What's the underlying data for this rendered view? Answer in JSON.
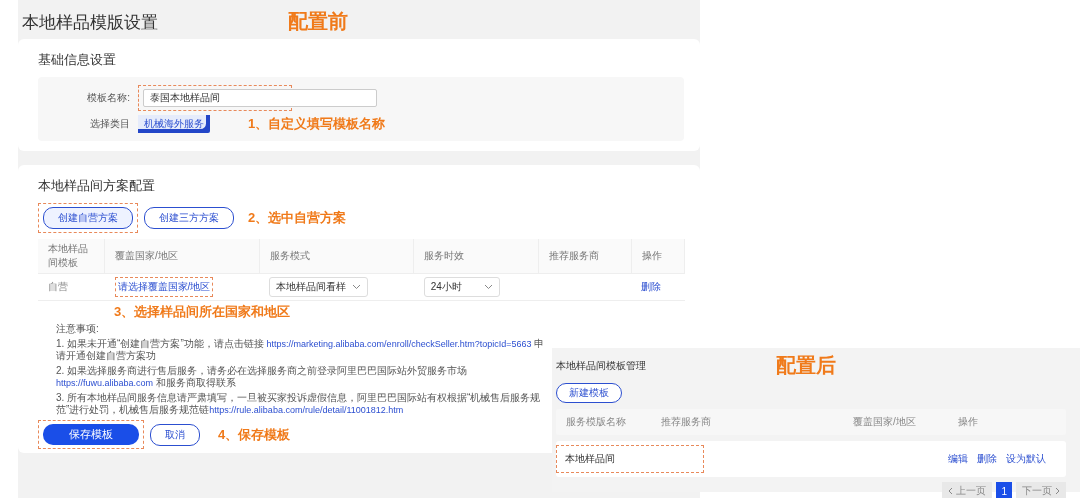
{
  "page_title": "本地样品模版设置",
  "before_label": "配置前",
  "basic": {
    "title": "基础信息设置",
    "name_label": "模板名称:",
    "name_value": "泰国本地样品间",
    "category_label": "选择类目",
    "category_tag": "机械海外服务",
    "hint": "1、自定义填写模板名称"
  },
  "plan": {
    "title": "本地样品间方案配置",
    "buttons": [
      {
        "label": "创建自营方案",
        "selected": true
      },
      {
        "label": "创建三方方案",
        "selected": false
      }
    ],
    "hint": "2、选中自营方案",
    "columns": [
      "本地样品间模板",
      "覆盖国家/地区",
      "服务模式",
      "服务时效",
      "推荐服务商",
      "操作"
    ],
    "row": {
      "type": "自营",
      "region_link": "请选择覆盖国家/地区",
      "mode": "本地样品间看样",
      "time": "24小时",
      "action": "删除"
    },
    "region_hint": "3、选择样品间所在国家和地区"
  },
  "notes": {
    "title": "注意事项:",
    "items": [
      {
        "text": "1. 如果未开通“创建自营方案”功能，请点击链接 ",
        "link": "https://marketing.alibaba.com/enroll/checkSeller.htm?topicId=5663",
        "after": " 申请开通创建自营方案功"
      },
      {
        "text": "2. 如果选择服务商进行售后服务，请务必在选择服务商之前登录阿里巴巴国际站外贸服务市场 ",
        "link": "https://fuwu.alibaba.com",
        "after": " 和服务商取得联系"
      },
      {
        "text": "3. 所有本地样品间服务信息请严肃填写，一旦被买家投诉虚假信息，阿里巴巴国际站有权根据“机械售后服务规范”进行处罚，机械售后服务规范链",
        "link": "https://rule.alibaba.com/rule/detail/11001812.htm"
      }
    ]
  },
  "footer": {
    "save": "保存模板",
    "cancel": "取消",
    "hint": "4、保存模板"
  },
  "after": {
    "title": "本地样品间模板管理",
    "label": "配置后",
    "new_button": "新建模板",
    "columns": [
      "服务模版名称",
      "推荐服务商",
      "覆盖国家/地区",
      "操作"
    ],
    "row": {
      "name": "本地样品间",
      "actions": [
        "编辑",
        "删除",
        "设为默认"
      ]
    },
    "pager": {
      "prev": "上一页",
      "next": "下一页",
      "prev_disabled": true,
      "next_disabled": true,
      "pages": [
        {
          "label": "1",
          "selected": true
        }
      ]
    }
  }
}
